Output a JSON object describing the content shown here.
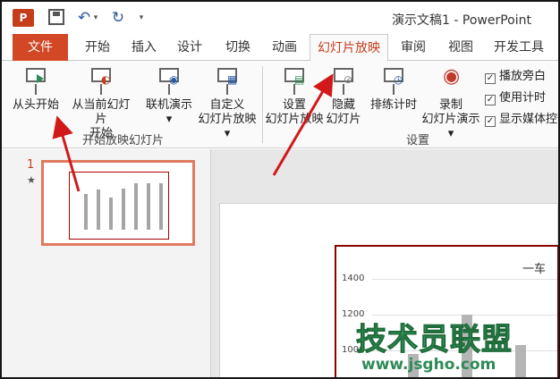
{
  "quick_access": {
    "app_logo": "P",
    "icons": [
      "powerpoint-logo",
      "save-icon",
      "undo-icon",
      "redo-icon"
    ]
  },
  "window": {
    "title": "演示文稿1 - PowerPoint"
  },
  "tabs": [
    {
      "label": "文件"
    },
    {
      "label": "开始"
    },
    {
      "label": "插入"
    },
    {
      "label": "设计"
    },
    {
      "label": "切换"
    },
    {
      "label": "动画"
    },
    {
      "label": "幻灯片放映"
    },
    {
      "label": "审阅"
    },
    {
      "label": "视图"
    },
    {
      "label": "开发工具"
    }
  ],
  "ribbon": {
    "start_group": {
      "label": "开始放映幻灯片",
      "from_beginning": "从头开始",
      "from_current_1": "从当前幻灯片",
      "from_current_2": "开始",
      "online_1": "联机演示",
      "custom_1": "自定义",
      "custom_2": "幻灯片放映"
    },
    "setup_group": {
      "label": "设置",
      "setup_1": "设置",
      "setup_2": "幻灯片放映",
      "hide_1": "隐藏",
      "hide_2": "幻灯片",
      "rehearse": "排练计时",
      "record_1": "录制",
      "record_2": "幻灯片演示"
    },
    "checkboxes": [
      {
        "label": "播放旁白",
        "checked": true
      },
      {
        "label": "使用计时",
        "checked": true
      },
      {
        "label": "显示媒体控件",
        "checked": true
      }
    ]
  },
  "thumbnail": {
    "number": "1",
    "mark": "★"
  },
  "slide_chart": {
    "title": "一车",
    "ticks": [
      "1400",
      "1200",
      "1000"
    ]
  },
  "watermark": {
    "cn": "技术员联盟",
    "url": "www.jsgho.com"
  },
  "colors": {
    "accent": "#c43e1c",
    "file_tab": "#d24726",
    "arrow": "#d11919"
  }
}
